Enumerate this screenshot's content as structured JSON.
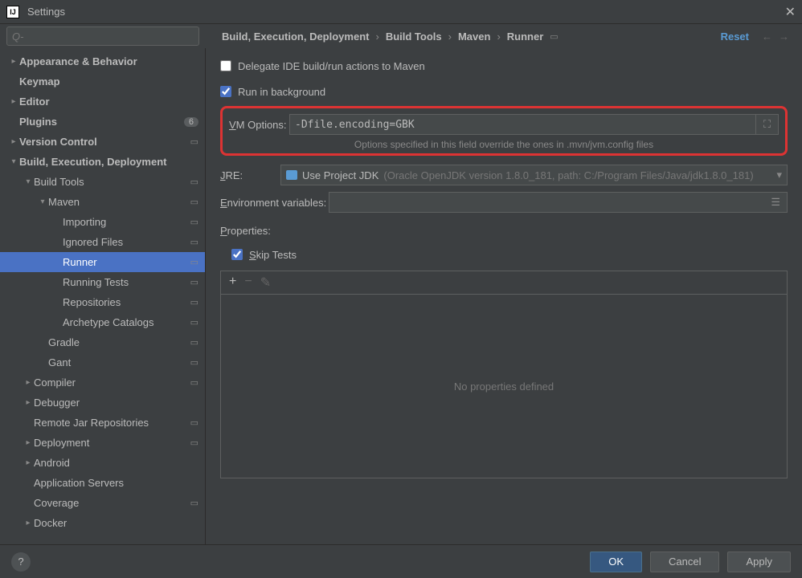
{
  "window": {
    "title": "Settings"
  },
  "search": {
    "placeholder": "Q-"
  },
  "breadcrumb": {
    "items": [
      "Build, Execution, Deployment",
      "Build Tools",
      "Maven",
      "Runner"
    ]
  },
  "reset_label": "Reset",
  "sidebar": {
    "badge_count": "6",
    "items": [
      {
        "label": "Appearance & Behavior",
        "depth": 0,
        "arrow": ">",
        "bold": true
      },
      {
        "label": "Keymap",
        "depth": 0,
        "arrow": "",
        "bold": true
      },
      {
        "label": "Editor",
        "depth": 0,
        "arrow": ">",
        "bold": true
      },
      {
        "label": "Plugins",
        "depth": 0,
        "arrow": "",
        "bold": true,
        "badge": true
      },
      {
        "label": "Version Control",
        "depth": 0,
        "arrow": ">",
        "bold": true,
        "proj": true
      },
      {
        "label": "Build, Execution, Deployment",
        "depth": 0,
        "arrow": "v",
        "bold": true
      },
      {
        "label": "Build Tools",
        "depth": 1,
        "arrow": "v",
        "proj": true
      },
      {
        "label": "Maven",
        "depth": 2,
        "arrow": "v",
        "proj": true
      },
      {
        "label": "Importing",
        "depth": 3,
        "arrow": "",
        "proj": true
      },
      {
        "label": "Ignored Files",
        "depth": 3,
        "arrow": "",
        "proj": true
      },
      {
        "label": "Runner",
        "depth": 3,
        "arrow": "",
        "proj": true,
        "selected": true
      },
      {
        "label": "Running Tests",
        "depth": 3,
        "arrow": "",
        "proj": true
      },
      {
        "label": "Repositories",
        "depth": 3,
        "arrow": "",
        "proj": true
      },
      {
        "label": "Archetype Catalogs",
        "depth": 3,
        "arrow": "",
        "proj": true
      },
      {
        "label": "Gradle",
        "depth": 2,
        "arrow": "",
        "proj": true
      },
      {
        "label": "Gant",
        "depth": 2,
        "arrow": "",
        "proj": true
      },
      {
        "label": "Compiler",
        "depth": 1,
        "arrow": ">",
        "proj": true
      },
      {
        "label": "Debugger",
        "depth": 1,
        "arrow": ">"
      },
      {
        "label": "Remote Jar Repositories",
        "depth": 1,
        "arrow": "",
        "proj": true
      },
      {
        "label": "Deployment",
        "depth": 1,
        "arrow": ">",
        "proj": true
      },
      {
        "label": "Android",
        "depth": 1,
        "arrow": ">"
      },
      {
        "label": "Application Servers",
        "depth": 1,
        "arrow": ""
      },
      {
        "label": "Coverage",
        "depth": 1,
        "arrow": "",
        "proj": true
      },
      {
        "label": "Docker",
        "depth": 1,
        "arrow": ">"
      }
    ]
  },
  "form": {
    "delegate_label": "Delegate IDE build/run actions to Maven",
    "delegate_checked": false,
    "run_bg_label": "Run in background",
    "run_bg_checked": true,
    "vm_options_label": "VM Options:",
    "vm_options_value": "-Dfile.encoding=GBK",
    "vm_options_hint": "Options specified in this field override the ones in .mvn/jvm.config files",
    "jre_label": "JRE:",
    "jre_primary": "Use Project JDK",
    "jre_secondary": "(Oracle OpenJDK version 1.8.0_181, path: C:/Program Files/Java/jdk1.8.0_181)",
    "env_label": "Environment variables:",
    "env_value": "",
    "properties_label": "Properties:",
    "skip_tests_label": "Skip Tests",
    "skip_tests_checked": true,
    "no_properties": "No properties defined"
  },
  "footer": {
    "ok": "OK",
    "cancel": "Cancel",
    "apply": "Apply"
  }
}
